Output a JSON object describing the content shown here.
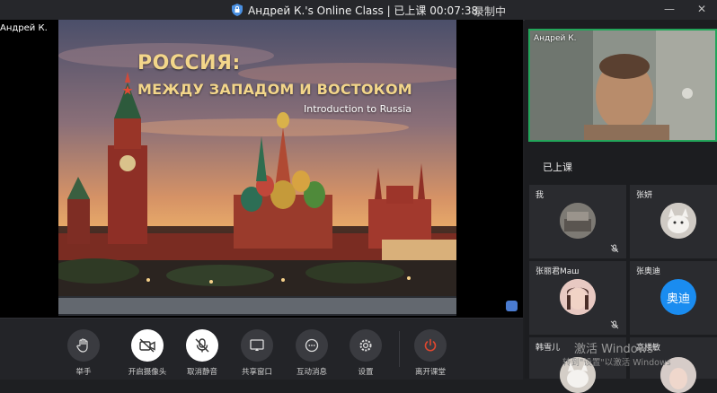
{
  "titlebar": {
    "title": "Андрей К.'s Online Class | 已上课 00:07:38",
    "recording": "录制中",
    "minimize": "—",
    "close": "✕"
  },
  "stage": {
    "owner_name": "Андрей К.",
    "slide": {
      "title_line1": "РОССИЯ:",
      "title_line2": "МЕЖДУ ЗАПАДОМ И ВОСТОКОМ",
      "subtitle": "Introduction to Russia"
    }
  },
  "toolbar": {
    "items": [
      {
        "label": "举手",
        "icon": "raise-hand-icon"
      },
      {
        "label": "开启摄像头",
        "icon": "camera-off-icon"
      },
      {
        "label": "取消静音",
        "icon": "mic-muted-icon"
      },
      {
        "label": "共享窗口",
        "icon": "share-screen-icon"
      },
      {
        "label": "互动消息",
        "icon": "chat-bubble-icon"
      },
      {
        "label": "设置",
        "icon": "gear-icon"
      },
      {
        "label": "离开课堂",
        "icon": "power-icon"
      }
    ]
  },
  "right_panel": {
    "teacher_name": "Андрей К.",
    "section_title": "已上课",
    "participants": [
      {
        "name": "我",
        "muted": true
      },
      {
        "name": "张妍",
        "muted": false
      },
      {
        "name": "张丽君Маш",
        "muted": true
      },
      {
        "name": "张奥迪",
        "muted": false,
        "avatar_text": "奥迪"
      },
      {
        "name": "韩雪儿",
        "muted": false
      },
      {
        "name": "高楼敏",
        "muted": false
      }
    ],
    "watermark_line1": "激活 Windows",
    "watermark_line2": "转到\"设置\"以激活 Windows"
  },
  "colors": {
    "accent_green": "#23a55a",
    "leave_red": "#e0472f",
    "slide_gold": "#f3d68a"
  }
}
